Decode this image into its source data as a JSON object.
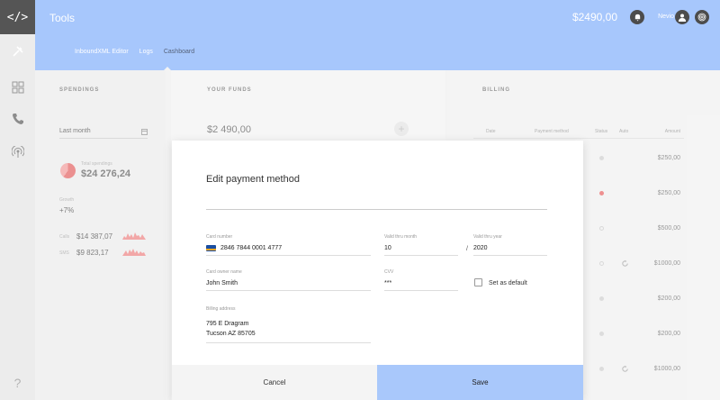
{
  "app": {
    "logo": "</>",
    "title": "Tools"
  },
  "header": {
    "balance": "$2490,00",
    "user_name": "Nevio",
    "icons": [
      "notification-bell-icon",
      "user-avatar-icon",
      "fingerprint-icon"
    ]
  },
  "subnav": {
    "items": [
      {
        "label": "InboundXML Editor"
      },
      {
        "label": "Logs"
      },
      {
        "label": "Cashboard",
        "active": true
      }
    ]
  },
  "rail": {
    "items": [
      "tools-icon",
      "dashboard-icon",
      "phone-icon",
      "broadcast-icon"
    ],
    "help": "?"
  },
  "spendings": {
    "title": "SPENDINGS",
    "period": "Last month",
    "total_label": "Total spendings",
    "total_value": "$24 276,24",
    "growth_label": "Growth",
    "growth_value": "+7%",
    "stats": [
      {
        "label": "Calls",
        "value": "$14 387,07"
      },
      {
        "label": "SMS",
        "value": "$9 823,17"
      }
    ]
  },
  "funds": {
    "title": "YOUR FUNDS",
    "value": "$2 490,00",
    "add_symbol": "+"
  },
  "billing": {
    "title": "BILLING",
    "columns": [
      "Date",
      "Payment method",
      "Status",
      "Auto",
      "Amount"
    ],
    "rows": [
      {
        "status": "grey",
        "auto": false,
        "amount": "$250,00"
      },
      {
        "status": "red",
        "auto": false,
        "amount": "$250,00"
      },
      {
        "status": "hollow",
        "auto": false,
        "amount": "$500,00"
      },
      {
        "status": "hollow",
        "auto": true,
        "amount": "$1000,00"
      },
      {
        "status": "grey",
        "auto": false,
        "amount": "$200,00"
      },
      {
        "status": "grey",
        "auto": false,
        "amount": "$200,00"
      },
      {
        "status": "grey",
        "auto": true,
        "amount": "$1000,00"
      }
    ]
  },
  "modal": {
    "title": "Edit payment method",
    "card_number_label": "Card number",
    "card_number": "2846 7844 0001 4777",
    "valid_month_label": "Valid thru month",
    "valid_month": "10",
    "valid_separator": "/",
    "valid_year_label": "Valid thru year",
    "valid_year": "2020",
    "owner_label": "Card owner name",
    "owner": "John Smith",
    "cvv_label": "CVV",
    "cvv": "***",
    "default_label": "Set as default",
    "default_checked": false,
    "address_label": "Billing address",
    "address_line1": "795 E Dragram",
    "address_line2": "Tucson AZ 85705",
    "cancel_label": "Cancel",
    "save_label": "Save"
  },
  "colors": {
    "header": "#8ab4fb",
    "save": "#a9c8fb",
    "accent_red": "#e96b6b"
  }
}
